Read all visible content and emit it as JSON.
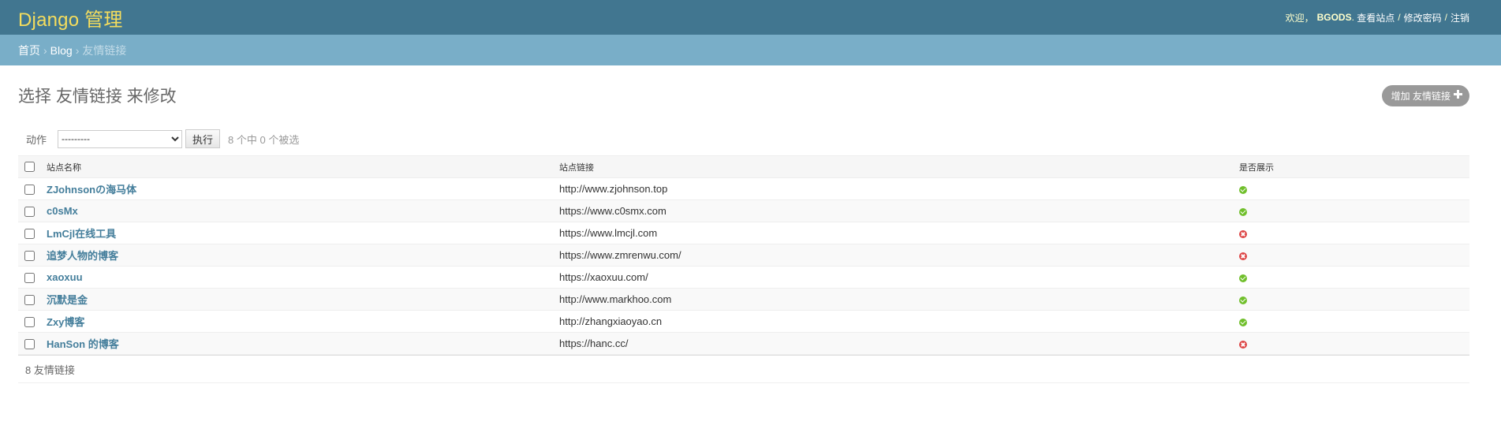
{
  "header": {
    "brand": "Django 管理",
    "welcome": "欢迎，",
    "username": "BGODS",
    "view_site": "查看站点",
    "change_password": "修改密码",
    "logout": "注销",
    "sep": "/"
  },
  "breadcrumbs": {
    "home": "首页",
    "app": "Blog",
    "current": "友情链接",
    "sep": "›"
  },
  "page": {
    "title": "选择 友情链接 来修改",
    "add_button": "增加 友情链接"
  },
  "actions": {
    "label": "动作",
    "selected_option": "---------",
    "go_button": "执行",
    "counter": "8 个中 0 个被选"
  },
  "table": {
    "columns": [
      "站点名称",
      "站点链接",
      "是否展示"
    ],
    "rows": [
      {
        "name": "ZJohnsonの海马体",
        "url": "http://www.zjohnson.top",
        "shown": true
      },
      {
        "name": "c0sMx",
        "url": "https://www.c0smx.com",
        "shown": true
      },
      {
        "name": "LmCjl在线工具",
        "url": "https://www.lmcjl.com",
        "shown": false
      },
      {
        "name": "追梦人物的博客",
        "url": "https://www.zmrenwu.com/",
        "shown": false
      },
      {
        "name": "xaoxuu",
        "url": "https://xaoxuu.com/",
        "shown": true
      },
      {
        "name": "沉默是金",
        "url": "http://www.markhoo.com",
        "shown": true
      },
      {
        "name": "Zxy博客",
        "url": "http://zhangxiaoyao.cn",
        "shown": true
      },
      {
        "name": "HanSon 的博客",
        "url": "https://hanc.cc/",
        "shown": false
      }
    ]
  },
  "footer": {
    "count": "8 友情链接"
  },
  "colors": {
    "header_bg": "#417690",
    "breadcrumb_bg": "#79aec8",
    "brand": "#f5dd5d",
    "link": "#447e9b",
    "yes": "#70bf2b",
    "no": "#dd4646"
  }
}
